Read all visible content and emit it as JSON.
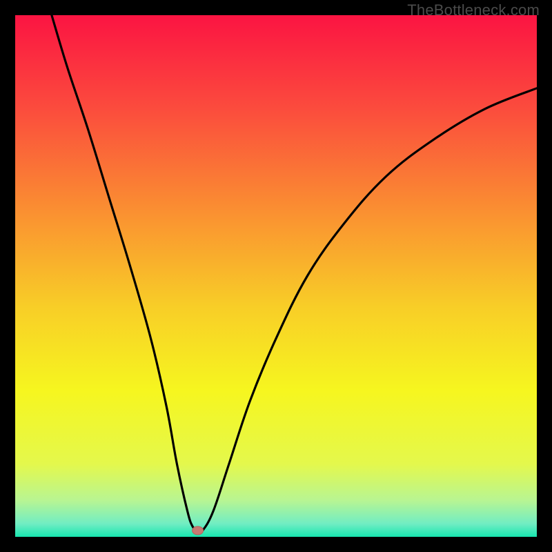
{
  "watermark": "TheBottleneck.com",
  "colors": {
    "frame": "#000000",
    "curve": "#000000",
    "marker_fill": "#c77a73",
    "marker_stroke": "#b6625c"
  },
  "chart_data": {
    "type": "line",
    "title": "",
    "xlabel": "",
    "ylabel": "",
    "xlim": [
      0,
      100
    ],
    "ylim": [
      0,
      100
    ],
    "optimum": {
      "x": 35,
      "y": 1.2
    },
    "curve": [
      {
        "x": 7,
        "y": 100
      },
      {
        "x": 10,
        "y": 90
      },
      {
        "x": 14,
        "y": 78
      },
      {
        "x": 18,
        "y": 65
      },
      {
        "x": 22,
        "y": 52
      },
      {
        "x": 26,
        "y": 38
      },
      {
        "x": 29,
        "y": 25
      },
      {
        "x": 31,
        "y": 14
      },
      {
        "x": 33,
        "y": 5
      },
      {
        "x": 34,
        "y": 2
      },
      {
        "x": 35,
        "y": 1.2
      },
      {
        "x": 36,
        "y": 1.3
      },
      {
        "x": 38,
        "y": 5
      },
      {
        "x": 41,
        "y": 14
      },
      {
        "x": 45,
        "y": 26
      },
      {
        "x": 50,
        "y": 38
      },
      {
        "x": 56,
        "y": 50
      },
      {
        "x": 63,
        "y": 60
      },
      {
        "x": 71,
        "y": 69
      },
      {
        "x": 80,
        "y": 76
      },
      {
        "x": 90,
        "y": 82
      },
      {
        "x": 100,
        "y": 86
      }
    ],
    "gradient_stops": [
      {
        "offset": 0,
        "color": "#fb1442"
      },
      {
        "offset": 0.18,
        "color": "#fb4c3d"
      },
      {
        "offset": 0.38,
        "color": "#fa9131"
      },
      {
        "offset": 0.56,
        "color": "#f8ce27"
      },
      {
        "offset": 0.72,
        "color": "#f6f61f"
      },
      {
        "offset": 0.86,
        "color": "#e4f84c"
      },
      {
        "offset": 0.93,
        "color": "#b8f592"
      },
      {
        "offset": 0.975,
        "color": "#71edc3"
      },
      {
        "offset": 1.0,
        "color": "#17e6b0"
      }
    ]
  }
}
